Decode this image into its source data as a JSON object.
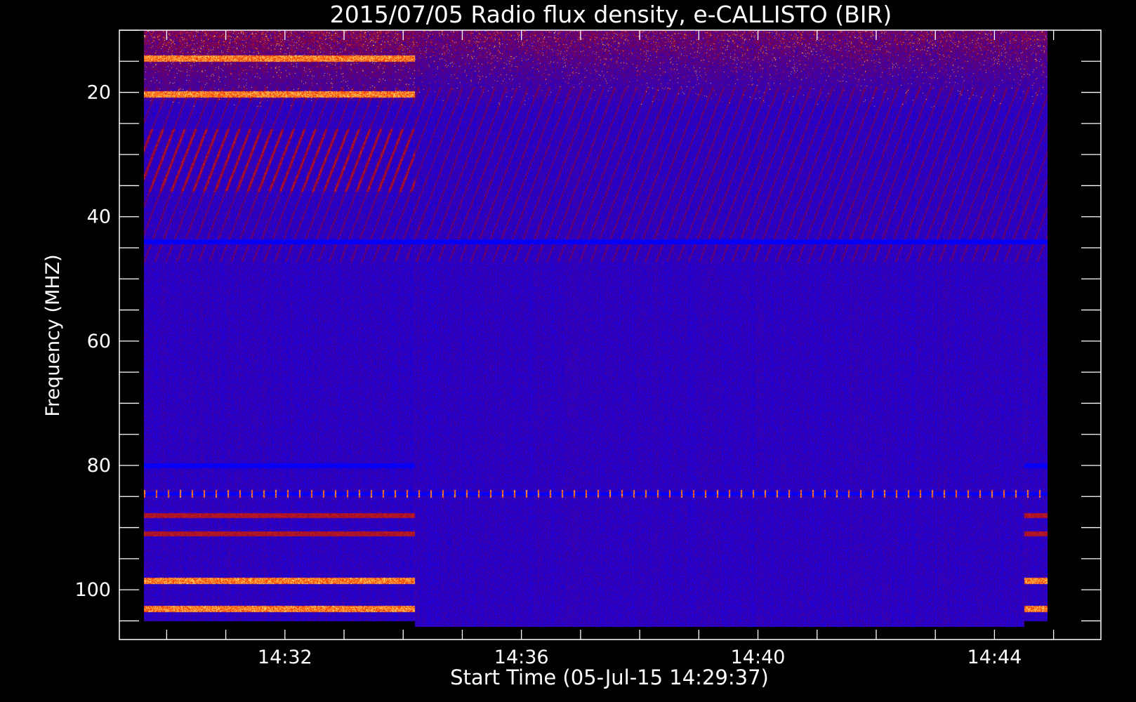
{
  "chart_data": {
    "type": "heatmap",
    "title": "2015/07/05  Radio flux density, e-CALLISTO (BIR)",
    "xlabel": "Start Time (05-Jul-15 14:29:37)",
    "ylabel": "Frequency (MHZ)",
    "x_tick_labels": [
      "14:32",
      "14:36",
      "14:40",
      "14:44"
    ],
    "x_ticks_minutes": [
      32,
      36,
      40,
      44
    ],
    "x_range_minutes": [
      29.2,
      45.8
    ],
    "x_data_range_minutes": [
      29.62,
      44.9
    ],
    "y_tick_labels": [
      "20",
      "40",
      "60",
      "80",
      "100"
    ],
    "y_ticks": [
      20,
      40,
      60,
      80,
      100
    ],
    "y_minor_step": 5,
    "y_range": [
      10,
      108
    ],
    "y_data_range": [
      10,
      105
    ],
    "y_inverted": true,
    "grid": false,
    "colors": {
      "background": "#000000",
      "low_intensity": "#0000ff",
      "mid_intensity": "#cc1800",
      "high_intensity": "#ffee66",
      "axes": "#ffffff"
    },
    "segments": [
      {
        "start_minute": 29.62,
        "end_minute": 34.2,
        "f_max": 105
      },
      {
        "start_minute": 34.2,
        "end_minute": 44.5,
        "f_max": 106
      },
      {
        "start_minute": 44.5,
        "end_minute": 44.9,
        "f_max": 105
      }
    ],
    "interference_bands": [
      {
        "f": 80.0,
        "kind": "dark",
        "segments": [
          0,
          2
        ]
      },
      {
        "f": 84.5,
        "kind": "speckle",
        "segments": [
          0,
          1,
          2
        ]
      },
      {
        "f": 88.0,
        "kind": "red",
        "segments": [
          0,
          2
        ]
      },
      {
        "f": 91.0,
        "kind": "red",
        "segments": [
          0,
          2
        ]
      },
      {
        "f": 98.5,
        "kind": "hot",
        "segments": [
          0,
          2
        ]
      },
      {
        "f": 103.0,
        "kind": "hot",
        "segments": [
          0,
          2
        ]
      },
      {
        "f": 14.5,
        "kind": "hot",
        "segments": [
          0
        ]
      },
      {
        "f": 20.3,
        "kind": "hot",
        "segments": [
          0
        ]
      },
      {
        "f": 44.0,
        "kind": "dark",
        "segments": [
          0,
          1,
          2
        ]
      }
    ]
  }
}
